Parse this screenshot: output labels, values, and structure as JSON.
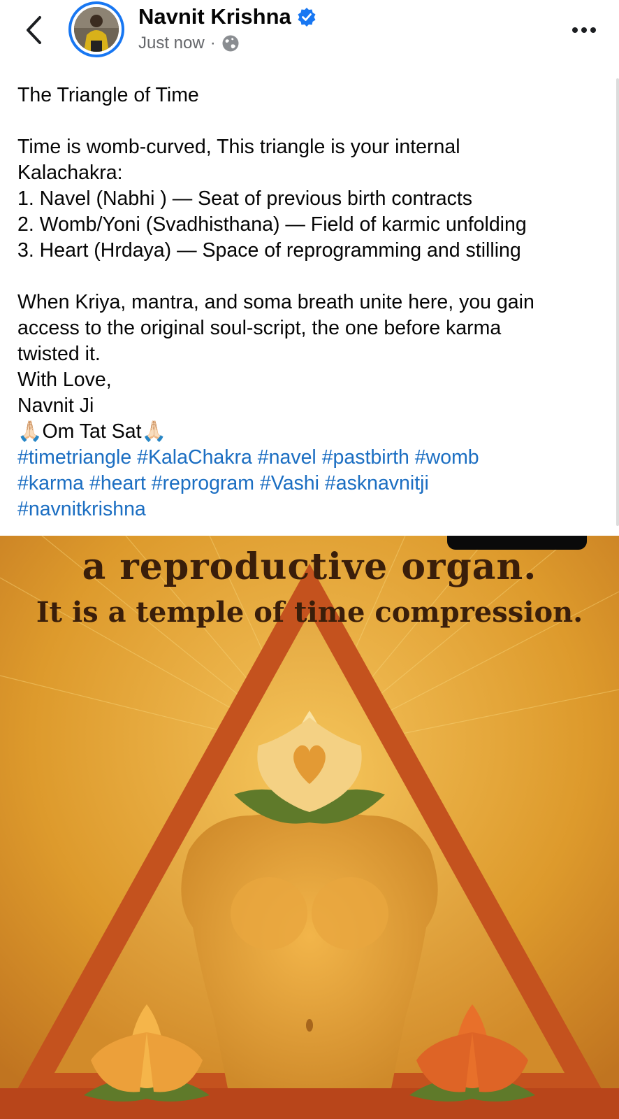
{
  "post": {
    "author": "Navnit Krishna",
    "time": "Just now",
    "separator": "·",
    "lines": [
      "The Triangle of Time",
      "",
      "Time is womb-curved, This triangle is your internal",
      "Kalachakra:",
      "1. Navel (Nabhi ) — Seat of previous birth contracts",
      "2. Womb/Yoni (Svadhisthana) — Field of karmic unfolding",
      "3. Heart (Hrdaya) — Space of reprogramming and stilling",
      "",
      "When Kriya, mantra, and soma breath unite here, you gain",
      "access to the original soul-script, the one before karma",
      "twisted it.",
      "With Love,",
      "Navnit Ji",
      "🙏🏻Om Tat Sat🙏🏻"
    ],
    "hashtags_line1": [
      "#timetriangle",
      "#KalaChakra",
      "#navel",
      "#pastbirth",
      "#womb"
    ],
    "hashtags_line2": [
      "#karma",
      "#heart",
      "#reprogram",
      "#Vashi",
      "#asknavnitji"
    ],
    "hashtags_line3": [
      "#navnitkrishna"
    ]
  },
  "image": {
    "text_line1": "a reproductive organ.",
    "text_line2": "It is a temple of time compression."
  },
  "icons": {
    "back": "chevron-left-icon",
    "verified": "verified-badge-icon",
    "audience": "globe-icon",
    "more": "more-horizontal-icon"
  },
  "colors": {
    "accent": "#1877f2",
    "hashtag": "#1b6ec2",
    "meta": "#65676b"
  }
}
